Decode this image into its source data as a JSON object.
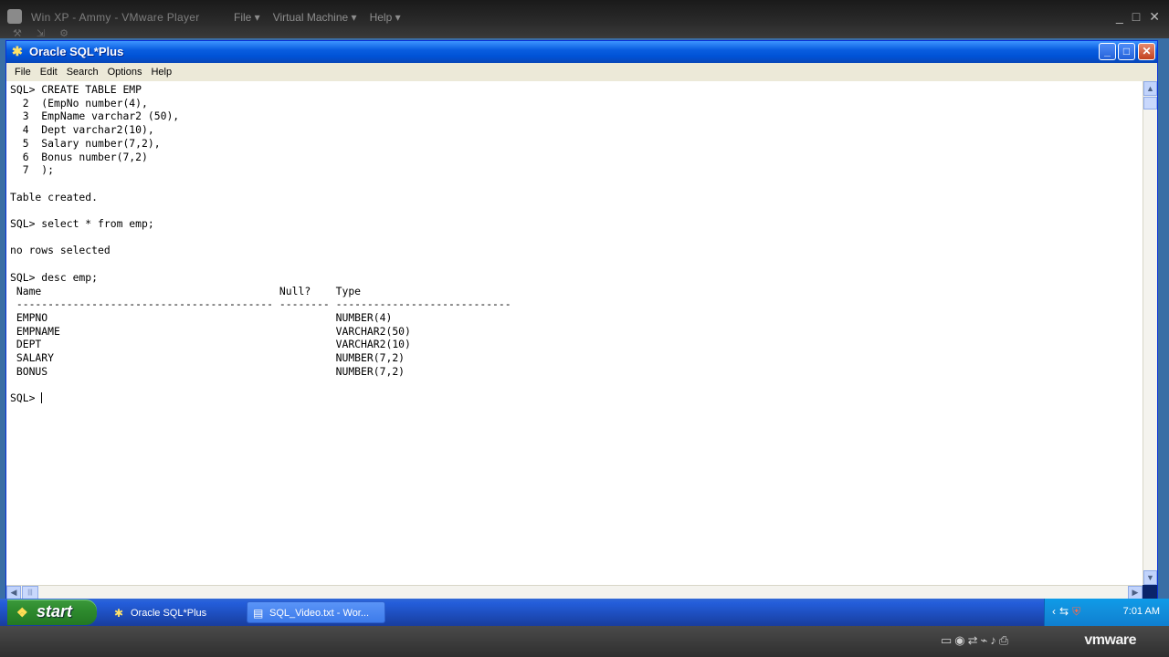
{
  "vmware": {
    "title": "Win XP - Ammy - VMware Player",
    "menus": [
      "File ▾",
      "Virtual Machine ▾",
      "Help ▾"
    ],
    "controls": [
      "_",
      "□",
      "✕"
    ],
    "logo": "vmware"
  },
  "window": {
    "title": "Oracle SQL*Plus",
    "controls": {
      "minimize": "_",
      "maximize": "□",
      "close": "✕"
    }
  },
  "menubar": {
    "items": [
      "File",
      "Edit",
      "Search",
      "Options",
      "Help"
    ]
  },
  "console": {
    "lines": [
      "SQL> CREATE TABLE EMP",
      "  2  (EmpNo number(4),",
      "  3  EmpName varchar2 (50),",
      "  4  Dept varchar2(10),",
      "  5  Salary number(7,2),",
      "  6  Bonus number(7,2)",
      "  7  );",
      "",
      "Table created.",
      "",
      "SQL> select * from emp;",
      "",
      "no rows selected",
      "",
      "SQL> desc emp;",
      " Name                                      Null?    Type",
      " ----------------------------------------- -------- ----------------------------",
      " EMPNO                                              NUMBER(4)",
      " EMPNAME                                            VARCHAR2(50)",
      " DEPT                                               VARCHAR2(10)",
      " SALARY                                             NUMBER(7,2)",
      " BONUS                                              NUMBER(7,2)",
      ""
    ],
    "prompt": "SQL> "
  },
  "taskbar": {
    "start_label": "start",
    "tasks": [
      {
        "label": "Oracle SQL*Plus",
        "icon": "sqlplus-icon"
      },
      {
        "label": "SQL_Video.txt - Wor...",
        "icon": "wordpad-icon"
      }
    ],
    "clock": "7:01 AM"
  }
}
